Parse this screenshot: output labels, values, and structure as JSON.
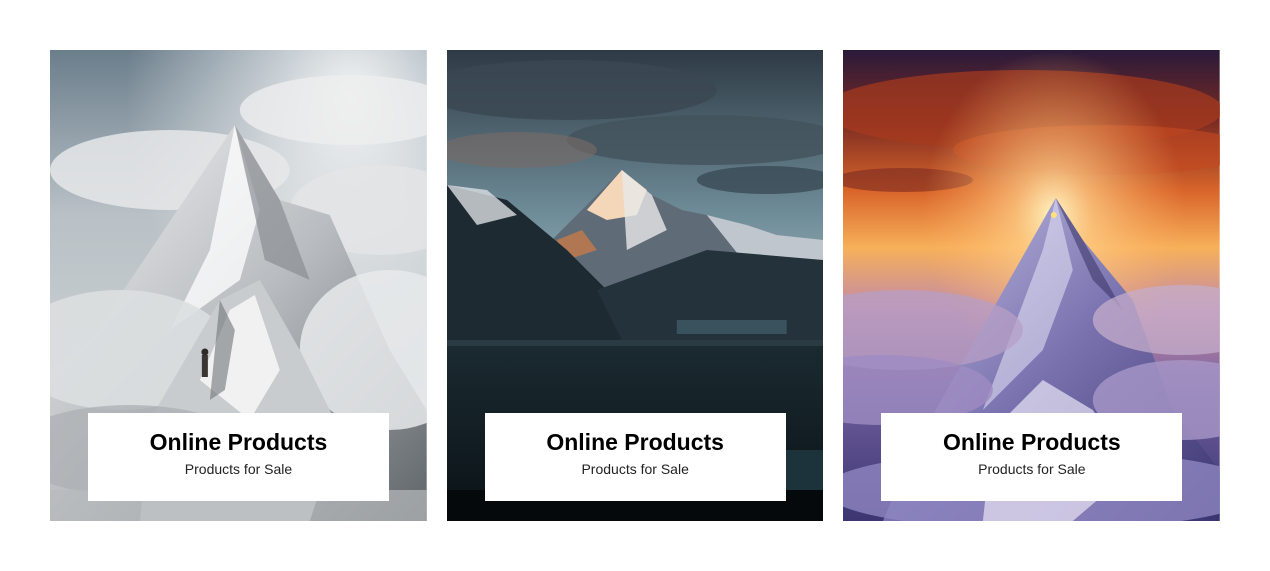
{
  "cards": [
    {
      "title": "Online Products",
      "subtitle": "Products for Sale",
      "image": "snowy-mountain-peak-with-hiker-image"
    },
    {
      "title": "Online Products",
      "subtitle": "Products for Sale",
      "image": "alpine-mountain-valley-at-dusk-image"
    },
    {
      "title": "Online Products",
      "subtitle": "Products for Sale",
      "image": "mountain-peak-at-sunset-above-clouds-image"
    }
  ]
}
